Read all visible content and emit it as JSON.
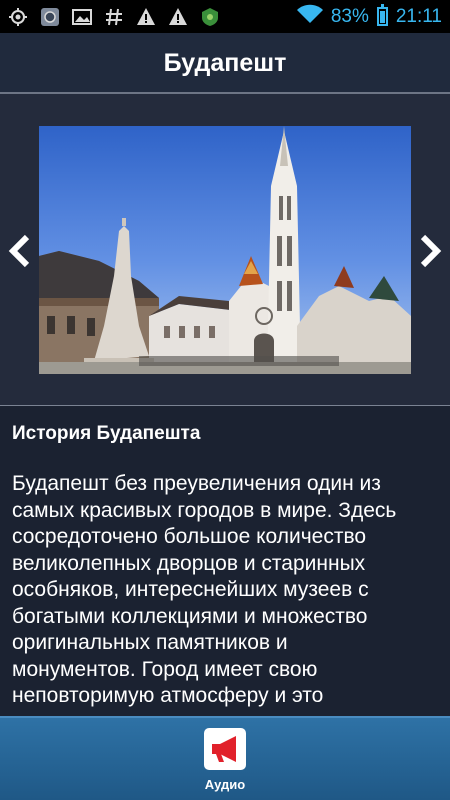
{
  "status_bar": {
    "battery_percent": "83%",
    "time": "21:11",
    "battery_level": 0.83,
    "icons": [
      "gps-icon",
      "photo-app-icon",
      "gallery-icon",
      "hash-icon",
      "warning-icon",
      "warning-icon",
      "android-icon",
      "wifi-icon",
      "battery-icon"
    ]
  },
  "header": {
    "title": "Будапешт"
  },
  "gallery": {
    "image_subject": "matthias-church-photo",
    "prev_icon": "chevron-left-icon",
    "next_icon": "chevron-right-icon"
  },
  "article": {
    "title": "История Будапешта",
    "lines": [
      "Будапешт без преувеличения один из",
      "самых красивых городов в мире. Здесь",
      "сосредоточено большое количество",
      "великолепных дворцов и старинных",
      "особняков, интереснейших музеев с",
      "богатыми коллекциями и множество",
      "оригинальных памятников и",
      "монументов. Город имеет свою",
      "неповторимую атмосферу и это"
    ]
  },
  "bottom_bar": {
    "audio_label": "Аудио",
    "audio_icon": "megaphone-icon"
  },
  "colors": {
    "status_accent": "#38b7f0",
    "background": "#1b2231",
    "header": "#202a3d",
    "bottom_bar": "#2e72a6",
    "audio_red": "#e1212b"
  }
}
